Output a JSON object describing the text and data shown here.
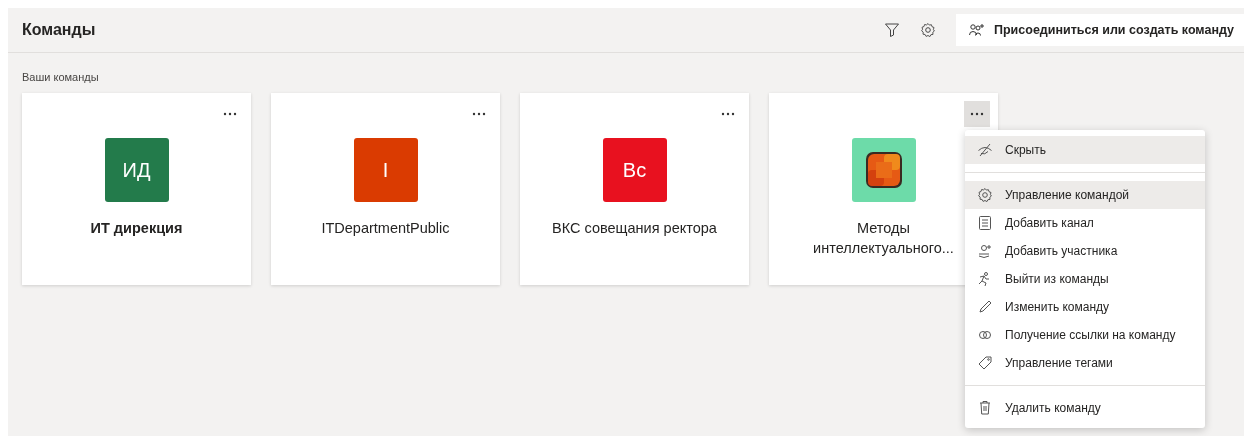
{
  "header": {
    "title": "Команды",
    "join_button": "Присоединиться или создать команду"
  },
  "section_label": "Ваши команды",
  "teams": [
    {
      "name": "ИТ дирекция",
      "bold": true,
      "avatar": {
        "kind": "initials",
        "text": "ИД",
        "color": "#237b4b"
      },
      "menu_open": false
    },
    {
      "name": "ITDepartmentPublic",
      "bold": false,
      "avatar": {
        "kind": "initials",
        "text": "I",
        "color": "#da3b01"
      },
      "menu_open": false
    },
    {
      "name": "ВКС совещания ректора",
      "bold": false,
      "avatar": {
        "kind": "initials",
        "text": "Вс",
        "color": "#e8111f"
      },
      "menu_open": false
    },
    {
      "name": "Методы интеллектуального...",
      "bold": false,
      "menu_open": true
    }
  ],
  "menu": {
    "groups": [
      [
        {
          "label": "Скрыть",
          "kind": "hide",
          "highlighted": true
        }
      ],
      [
        {
          "label": "Управление командой",
          "kind": "gear",
          "highlighted": true
        },
        {
          "label": "Добавить канал",
          "kind": "channel",
          "highlighted": false
        },
        {
          "label": "Добавить участника",
          "kind": "add-person",
          "highlighted": false
        },
        {
          "label": "Выйти из команды",
          "kind": "leave",
          "highlighted": false
        },
        {
          "label": "Изменить команду",
          "kind": "pencil",
          "highlighted": false
        },
        {
          "label": "Получение ссылки на команду",
          "kind": "link",
          "highlighted": false
        },
        {
          "label": "Управление тегами",
          "kind": "tag",
          "highlighted": false
        }
      ],
      [
        {
          "label": "Удалить команду",
          "kind": "trash",
          "highlighted": false
        }
      ]
    ]
  }
}
